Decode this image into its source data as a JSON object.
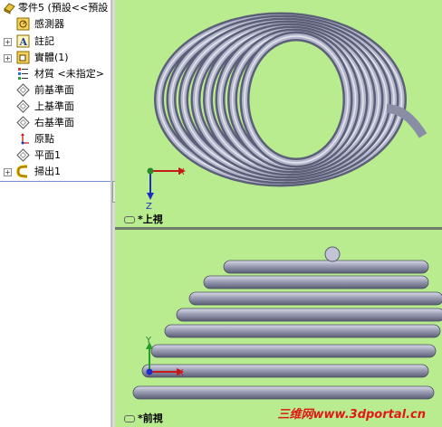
{
  "tree": {
    "items": [
      {
        "label": "零件5 (預設<<預設",
        "icon": "part-icon",
        "expand": ""
      },
      {
        "label": "感測器",
        "icon": "sensor-icon",
        "expand": ""
      },
      {
        "label": "註記",
        "icon": "annotation-icon",
        "expand": "+"
      },
      {
        "label": "實體(1)",
        "icon": "solid-body-icon",
        "expand": "+"
      },
      {
        "label": "材質 <未指定>",
        "icon": "material-icon",
        "expand": ""
      },
      {
        "label": "前基準面",
        "icon": "plane-icon",
        "expand": ""
      },
      {
        "label": "上基準面",
        "icon": "plane-icon",
        "expand": ""
      },
      {
        "label": "右基準面",
        "icon": "plane-icon",
        "expand": ""
      },
      {
        "label": "原點",
        "icon": "origin-icon",
        "expand": ""
      },
      {
        "label": "平面1",
        "icon": "plane-icon",
        "expand": ""
      },
      {
        "label": "掃出1",
        "icon": "sweep-icon",
        "expand": "+"
      }
    ]
  },
  "top_view": {
    "label": "*上視",
    "axes": {
      "x": "X",
      "z": "Z"
    },
    "colors": {
      "bg": "#b8ec8f",
      "spring": "#8c8fa8"
    }
  },
  "front_view": {
    "label": "*前視",
    "axes": {
      "x": "X",
      "y": "Y"
    },
    "colors": {
      "bg": "#b8ec8f",
      "spring": "#8c8fa8"
    }
  },
  "watermark": "三维网www.3dportal.cn"
}
